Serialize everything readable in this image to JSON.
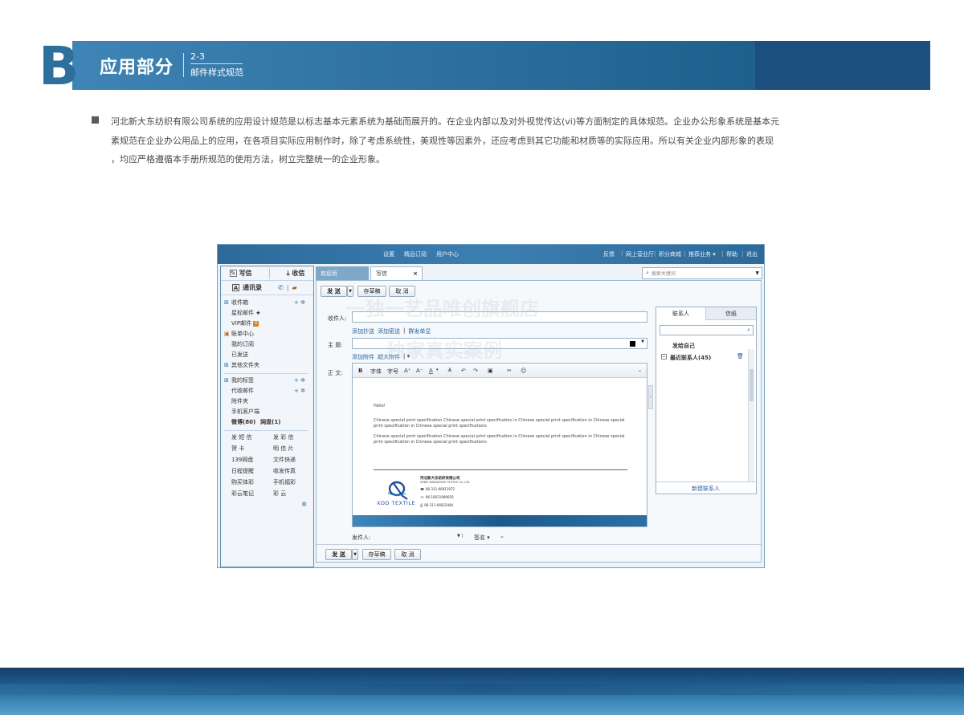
{
  "header": {
    "letter": "B",
    "section_title": "应用部分",
    "section_number": "2-3",
    "section_subtitle": "邮件样式规范"
  },
  "intro": {
    "line1": "河北新大东纺织有限公司系统的应用设计规范是以标志基本元素系统为基础而展开的。在企业内部以及对外视觉传达(vi)等方面制定的具体规范。企业办公形象系统是基本元",
    "line2": "素规范在企业办公用品上的应用，在各项目实际应用制作时，除了考虑系统性，美观性等因素外，还应考虑到其它功能和材质等的实际应用。所以有关企业内部形象的表现",
    "line3": "，均应严格遵循本手册所规范的使用方法，树立完整统一的企业形象。"
  },
  "mail_client": {
    "top_nav": [
      "设置",
      "精品订阅",
      "用户中心"
    ],
    "top_right": [
      "反馈",
      "网上营业厅",
      "积分商城",
      "推荐业务 ▾",
      "帮助",
      "退出"
    ],
    "write_label": "写信",
    "inbox_label": "收信",
    "contacts_label": "通讯录",
    "folders": [
      {
        "label": "收件箱",
        "prefix": "+",
        "bold": false
      },
      {
        "label": "星标邮件 ★",
        "prefix": "",
        "bold": false
      },
      {
        "label": "VIP邮件",
        "prefix": "",
        "bold": false
      },
      {
        "label": "账单中心",
        "prefix": "",
        "bold": false
      },
      {
        "label": "我的订阅",
        "prefix": "",
        "bold": false
      },
      {
        "label": "已发送",
        "prefix": "",
        "bold": false
      },
      {
        "label": "其他文件夹",
        "prefix": "+",
        "bold": false
      }
    ],
    "folders2": [
      {
        "label": "我的标签",
        "prefix": "+"
      },
      {
        "label": "代收邮件",
        "prefix": ""
      },
      {
        "label": "附件夹",
        "prefix": ""
      },
      {
        "label": "手机客户端",
        "prefix": ""
      }
    ],
    "weibo": "微博(80)",
    "tongxue": "网盘(1)",
    "services": [
      [
        "发 短 信",
        "发 彩 信"
      ],
      [
        "贺    卡",
        "明 信 片"
      ],
      [
        "139网盘",
        "文件快递"
      ],
      [
        "日程提醒",
        "收发传真"
      ],
      [
        "购买体彩",
        "手机福彩"
      ],
      [
        "彩云笔记",
        "彩    云"
      ]
    ],
    "tab_welcome": "欢迎页",
    "tab_write": "写信",
    "tab_close": "×",
    "search_placeholder": "搜索关键词",
    "send": "发 送",
    "save_draft": "存草稿",
    "cancel": "取 消",
    "to_label": "收件人:",
    "add_cc": "添加抄送",
    "add_bcc": "添加密送",
    "group_send": "群发单显",
    "subject_label": "主   题:",
    "add_attachment": "添加附件",
    "big_attachment": "超大附件",
    "body_label": "正   文:",
    "toolbar": [
      "B",
      "字体",
      "字号",
      "A⁺",
      "A⁻",
      "A",
      "≜",
      "↶",
      "↷",
      "▣",
      "✂",
      "☺"
    ],
    "body_hello": "Hello!",
    "body_para1": "Chinese special print specification Chinese special print specification in Chinese special print specification in Chinese special print specification in Chinese special print specifications",
    "body_para2": "Chinese special print specification Chinese special print specification in Chinese special print specification in Chinese special print specification in Chinese special print specifications",
    "sig_company_cn": "河北新大东纺织有限公司",
    "sig_company_en": "HEBEI XINDADONG TEXTILE CO.,LTD.",
    "sig_brand": "XDD TEXTILE",
    "sig_tel1": "86-311-66813972",
    "sig_tel2": "86-18031989650",
    "sig_tel3": "86-311-66822484",
    "sender_label": "发件人:",
    "signature_label": "签名 ▾",
    "contacts_tab": "联系人",
    "paper_tab": "信纸",
    "send_self": "发给自己",
    "recent_contacts": "最近联系人(45)",
    "new_contact": "新建联系人"
  },
  "watermark": {
    "line1": "一独一艺品唯创旗舰店",
    "line2": "独家真实案例"
  },
  "colors": {
    "brand_blue": "#2d6f9d",
    "dark_blue": "#1d4f7e",
    "link_blue": "#2b64a0"
  }
}
